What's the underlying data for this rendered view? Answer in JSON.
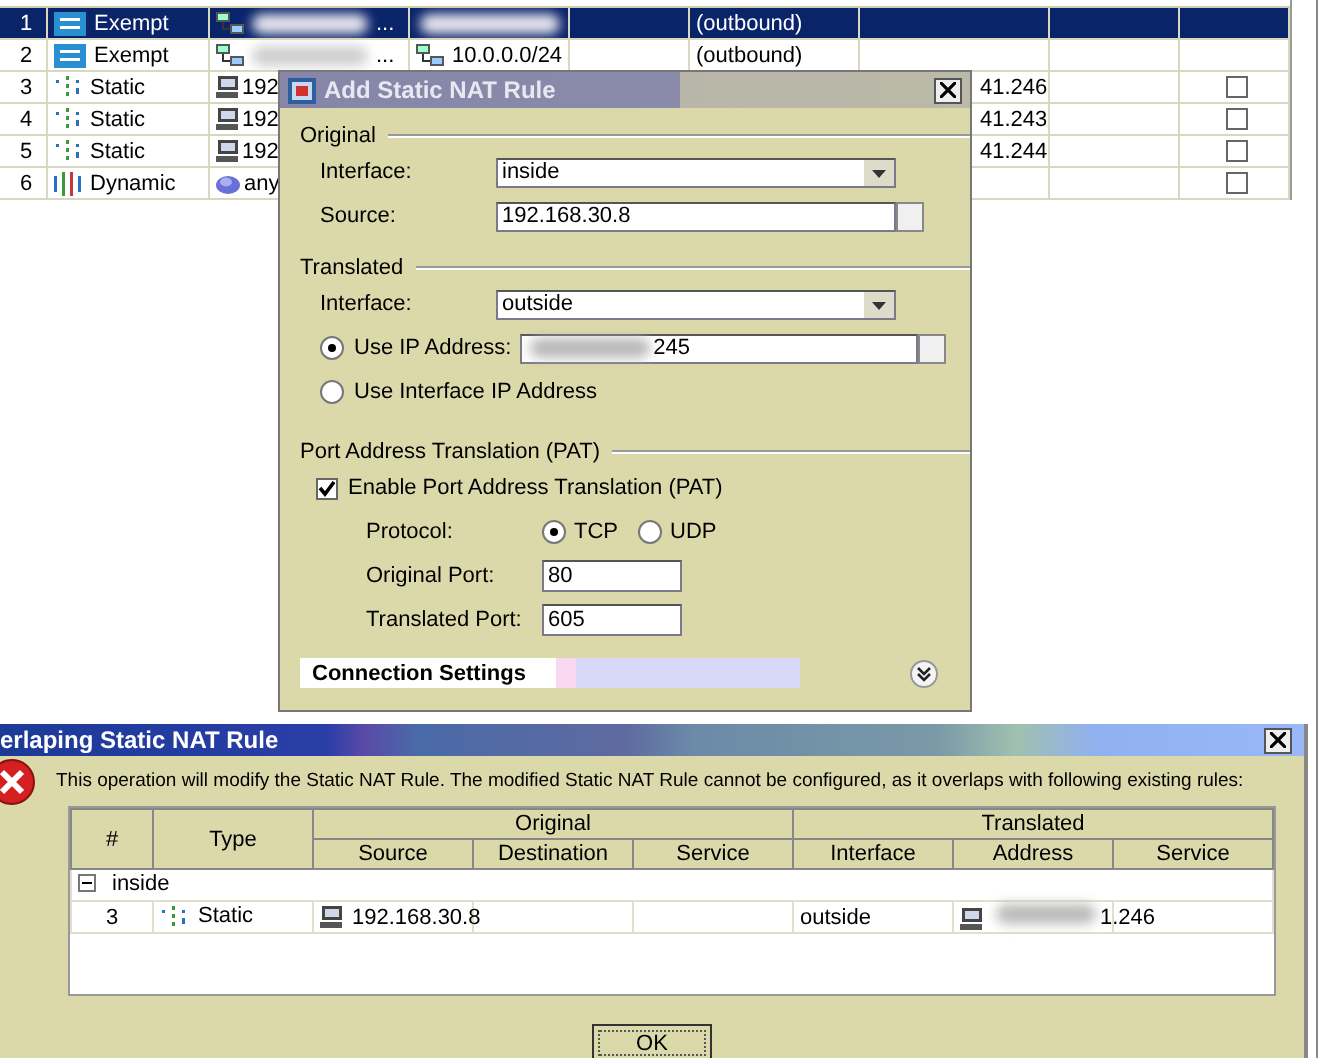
{
  "rules_table": {
    "rows": [
      {
        "number": "1",
        "type": "Exempt",
        "kind": "exempt",
        "selected": true,
        "source": {
          "kind": "network",
          "redacted": true,
          "text": "..."
        },
        "destination": {
          "kind": "none",
          "redacted": true
        },
        "direction": "(outbound)"
      },
      {
        "number": "2",
        "type": "Exempt",
        "kind": "exempt",
        "selected": false,
        "source": {
          "kind": "network",
          "redacted": true,
          "text": "..."
        },
        "destination": {
          "kind": "network",
          "text": "10.0.0.0/24"
        },
        "direction": "(outbound)"
      },
      {
        "number": "3",
        "type": "Static",
        "kind": "static",
        "selected": false,
        "source": {
          "kind": "host",
          "text": "192"
        },
        "translated": "41.246",
        "checked": false
      },
      {
        "number": "4",
        "type": "Static",
        "kind": "static",
        "selected": false,
        "source": {
          "kind": "host",
          "text": "192"
        },
        "translated": "41.243",
        "checked": false
      },
      {
        "number": "5",
        "type": "Static",
        "kind": "static",
        "selected": false,
        "source": {
          "kind": "host",
          "text": "192"
        },
        "translated": "41.244",
        "checked": false
      },
      {
        "number": "6",
        "type": "Dynamic",
        "kind": "dynamic",
        "selected": false,
        "source": {
          "kind": "any",
          "text": "any"
        },
        "checked": false
      }
    ]
  },
  "add_dialog": {
    "title": "Add Static NAT Rule",
    "sections": [
      {
        "title": "Original",
        "rows": [
          {
            "kind": "select",
            "label": "Interface:",
            "value": "inside"
          },
          {
            "kind": "browse",
            "label": "Source:",
            "value": "192.168.30.8"
          }
        ]
      },
      {
        "title": "Translated",
        "rows": [
          {
            "kind": "select",
            "label": "Interface:",
            "value": "outside"
          },
          {
            "kind": "radio-browse",
            "label": "Use IP Address:",
            "selected": true,
            "value": "245",
            "redacted": true
          },
          {
            "kind": "radio",
            "label": "Use Interface IP Address",
            "selected": false
          }
        ]
      },
      {
        "title": "Port Address Translation (PAT)",
        "rows": [
          {
            "kind": "checkbox",
            "label": "Enable Port Address Translation (PAT)",
            "checked": true
          },
          {
            "kind": "radio-group",
            "label": "Protocol:",
            "options": [
              {
                "label": "TCP",
                "selected": true
              },
              {
                "label": "UDP",
                "selected": false
              }
            ]
          },
          {
            "kind": "text",
            "label": "Original Port:",
            "value": "80"
          },
          {
            "kind": "text",
            "label": "Translated Port:",
            "value": "605"
          }
        ]
      }
    ],
    "collapsed_section": {
      "title": "Connection Settings",
      "expanded": false
    }
  },
  "error_dialog": {
    "title": "erlaping Static NAT Rule",
    "message": "This operation will modify the Static NAT Rule. The modified Static NAT Rule cannot be configured, as it overlaps with following existing rules:",
    "table": {
      "group_headers": [
        "Original",
        "Translated"
      ],
      "columns": [
        "#",
        "Type",
        "Source",
        "Destination",
        "Service",
        "Interface",
        "Address",
        "Service"
      ],
      "groups": [
        {
          "label": "inside",
          "expanded": true,
          "rows": [
            {
              "number": "3",
              "type": "Static",
              "kind": "static",
              "source": "192.168.30.8",
              "interface": "outside",
              "address": "1.246",
              "address_redacted": true
            }
          ]
        }
      ]
    },
    "buttons": [
      "OK"
    ]
  }
}
